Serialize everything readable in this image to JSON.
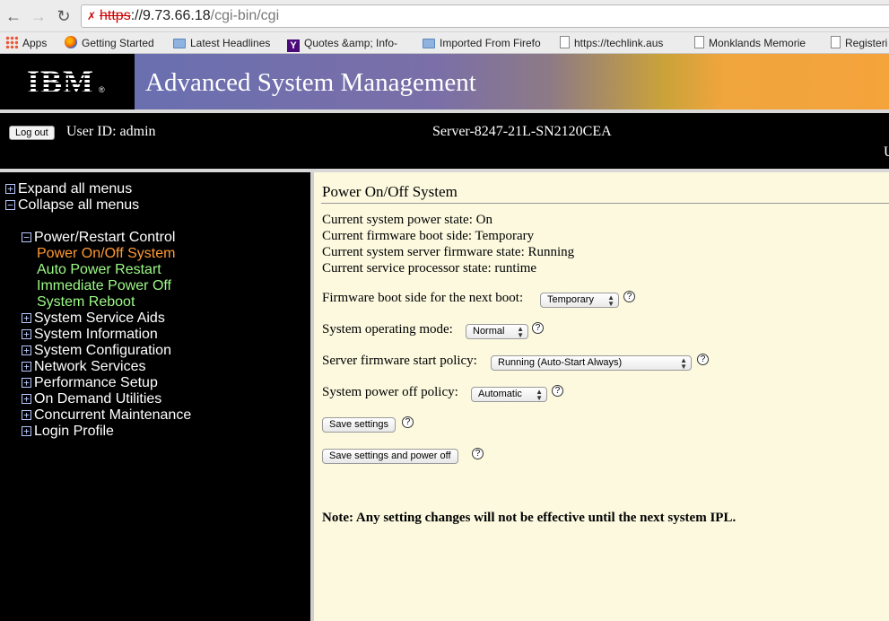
{
  "browser": {
    "url_scheme": "https",
    "url_host": "://9.73.66.18",
    "url_path": "/cgi-bin/cgi",
    "bookmarks": [
      {
        "label": "Apps",
        "icon": "apps-grid-icon"
      },
      {
        "label": "Getting Started",
        "icon": "firefox-icon"
      },
      {
        "label": "Latest Headlines",
        "icon": "folder-icon"
      },
      {
        "label": "Quotes &amp; Info-",
        "icon": "yahoo-icon"
      },
      {
        "label": "Imported From Firefo",
        "icon": "folder-icon"
      },
      {
        "label": "https://techlink.aus",
        "icon": "page-icon"
      },
      {
        "label": "Monklands Memorie",
        "icon": "page-icon"
      },
      {
        "label": "Registeri",
        "icon": "page-icon"
      }
    ]
  },
  "banner": {
    "logo": "IBM",
    "logo_mark": "®",
    "title": "Advanced System Management"
  },
  "header": {
    "logout_label": "Log out",
    "user_id": "User ID: admin",
    "server": "Server-8247-21L-SN2120CEA",
    "clipped_text": "U"
  },
  "sidebar": {
    "expand_all": "Expand all menus",
    "collapse_all": "Collapse all menus",
    "groups": [
      {
        "label": "Power/Restart Control",
        "state": "expanded"
      },
      {
        "label": "System Service Aids",
        "state": "collapsed"
      },
      {
        "label": "System Information",
        "state": "collapsed"
      },
      {
        "label": "System Configuration",
        "state": "collapsed"
      },
      {
        "label": "Network Services",
        "state": "collapsed"
      },
      {
        "label": "Performance Setup",
        "state": "collapsed"
      },
      {
        "label": "On Demand Utilities",
        "state": "collapsed"
      },
      {
        "label": "Concurrent Maintenance",
        "state": "collapsed"
      },
      {
        "label": "Login Profile",
        "state": "collapsed"
      }
    ],
    "power_items": [
      {
        "label": "Power On/Off System",
        "active": true
      },
      {
        "label": "Auto Power Restart",
        "active": false
      },
      {
        "label": "Immediate Power Off",
        "active": false
      },
      {
        "label": "System Reboot",
        "active": false
      }
    ]
  },
  "main": {
    "title": "Power On/Off System",
    "states": [
      "Current system power state: On",
      "Current firmware boot side: Temporary",
      "Current system server firmware state: Running",
      "Current service processor state: runtime"
    ],
    "settings": [
      {
        "label": "Firmware boot side for the next boot:",
        "value": "Temporary"
      },
      {
        "label": "System operating mode:",
        "value": "Normal"
      },
      {
        "label": "Server firmware start policy:",
        "value": "Running (Auto-Start Always)"
      },
      {
        "label": "System power off policy:",
        "value": "Automatic"
      }
    ],
    "help_mark": "?",
    "save_button": "Save settings",
    "save_power_off_button": "Save settings and power off",
    "note": "Note: Any setting changes will not be effective until the next system IPL."
  },
  "colors": {
    "content_bg": "#fcf9df",
    "submenu_green": "#9dfb86",
    "submenu_active": "#ff9933",
    "banner_orange": "#f5a33b"
  }
}
